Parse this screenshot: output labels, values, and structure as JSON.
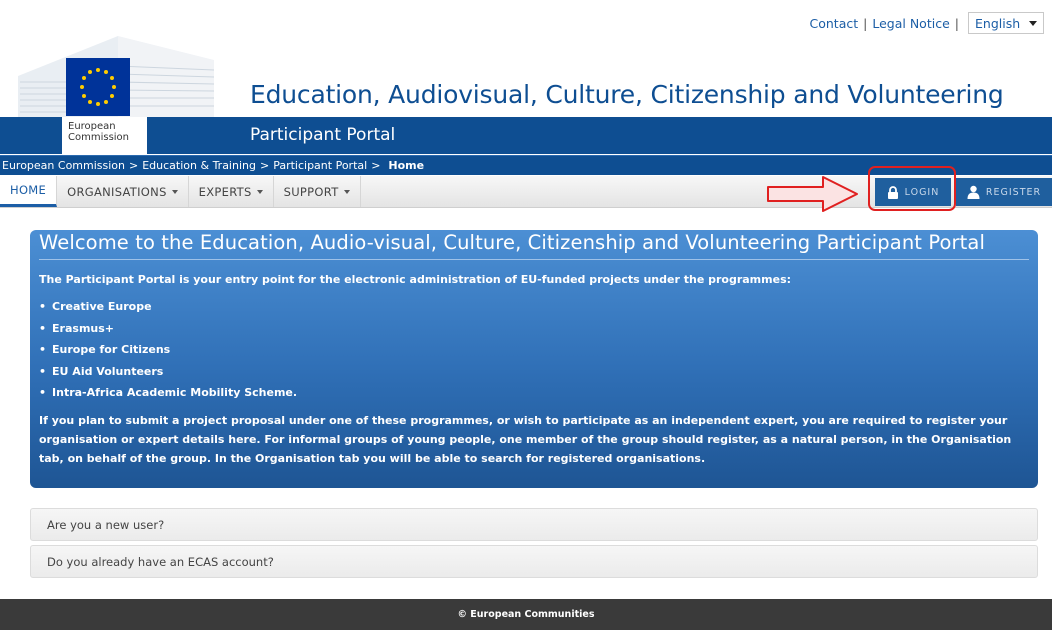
{
  "toplinks": {
    "contact": "Contact",
    "legal": "Legal Notice",
    "sep": "|",
    "language": "English"
  },
  "header": {
    "logo_line1": "European",
    "logo_line2": "Commission",
    "title": "Education, Audiovisual, Culture, Citizenship and Volunteering",
    "subtitle": "Participant Portal"
  },
  "breadcrumb": {
    "items": [
      "European Commission",
      "Education & Training",
      "Participant Portal"
    ],
    "current": "Home",
    "sep": ">"
  },
  "nav": {
    "home": "HOME",
    "organisations": "ORGANISATIONS",
    "experts": "EXPERTS",
    "support": "SUPPORT",
    "login": "LOGIN",
    "register": "REGISTER"
  },
  "welcome": {
    "title": "Welcome to the Education, Audio-visual, Culture, Citizenship and Volunteering Participant Portal",
    "intro": "The Participant Portal is your entry point for the electronic administration of EU-funded projects under the programmes:",
    "programmes": [
      "Creative Europe",
      "Erasmus+",
      "Europe for Citizens",
      "EU Aid Volunteers",
      "Intra-Africa Academic Mobility Scheme."
    ],
    "outro": "If you plan to submit a project proposal under one of these programmes, or wish to participate as an independent expert, you are required to register your organisation or expert details here. For informal groups of young people, one member of the group should register, as a natural person, in the Organisation tab, on behalf of the group. In the Organisation tab you will be able to search for registered organisations."
  },
  "accordion": {
    "new_user": "Are you a new user?",
    "ecas": "Do you already have an ECAS account?"
  },
  "footer": {
    "copyright": "© European Communities"
  },
  "colors": {
    "brand_blue": "#0e4e92",
    "panel_blue": "#2f6fb6",
    "highlight_red": "#e02020"
  }
}
